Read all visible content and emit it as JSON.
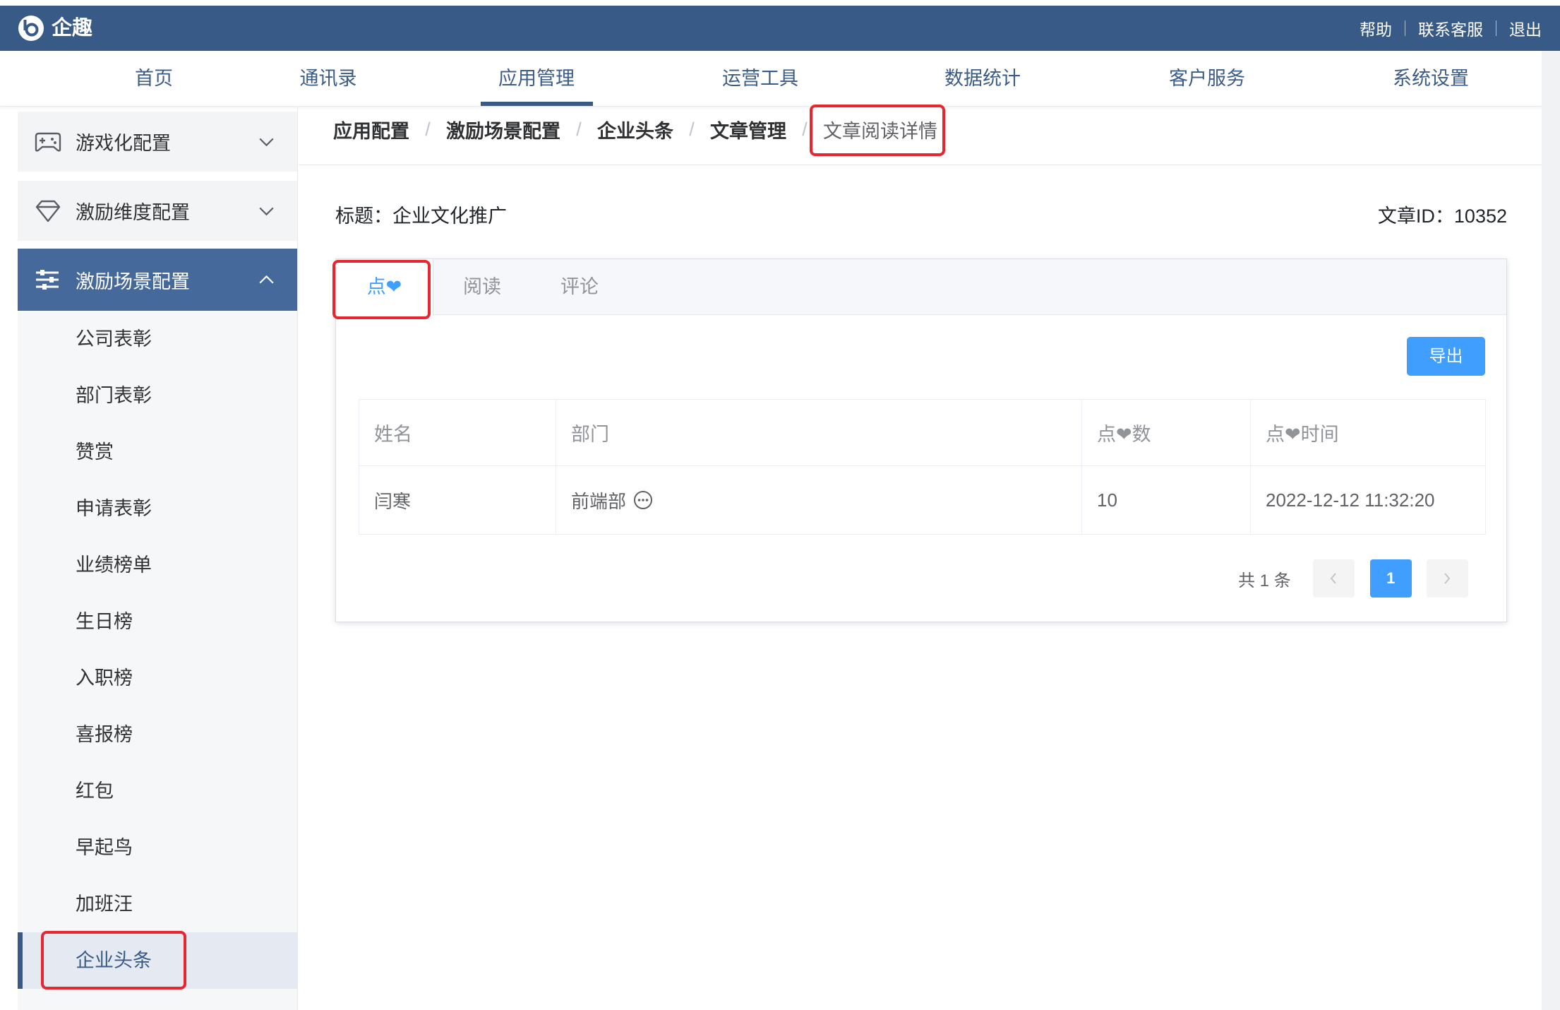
{
  "app": {
    "name": "企趣",
    "logo_icon": "qiqu-logo-icon"
  },
  "topbar": {
    "links": [
      "帮助",
      "联系客服",
      "退出"
    ]
  },
  "nav": {
    "items": [
      "首页",
      "通讯录",
      "应用管理",
      "运营工具",
      "数据统计",
      "客户服务",
      "系统设置"
    ],
    "active": "应用管理"
  },
  "sidebar": {
    "groups": [
      {
        "label": "游戏化配置",
        "icon": "gamepad-icon",
        "expanded": false
      },
      {
        "label": "激励维度配置",
        "icon": "diamond-icon",
        "expanded": false
      },
      {
        "label": "激励场景配置",
        "icon": "sliders-icon",
        "expanded": true
      }
    ],
    "sub_items": [
      "公司表彰",
      "部门表彰",
      "赞赏",
      "申请表彰",
      "业绩榜单",
      "生日榜",
      "入职榜",
      "喜报榜",
      "红包",
      "早起鸟",
      "加班汪",
      "企业头条"
    ],
    "selected": "企业头条"
  },
  "breadcrumb": {
    "items": [
      "应用配置",
      "激励场景配置",
      "企业头条",
      "文章管理",
      "文章阅读详情"
    ],
    "separator": "/"
  },
  "article": {
    "title_label": "标题：",
    "title": "企业文化推广",
    "id_label": "文章ID：",
    "id": "10352"
  },
  "tabs": {
    "items": [
      "点❤",
      "阅读",
      "评论"
    ],
    "active": "点❤"
  },
  "toolbar": {
    "export_label": "导出"
  },
  "table": {
    "columns": [
      "姓名",
      "部门",
      "点❤数",
      "点❤时间"
    ],
    "rows": [
      [
        "闫寒",
        "前端部",
        "10",
        "2022-12-12 11:32:20"
      ]
    ],
    "dept_icon": "more-circle-icon"
  },
  "pagination": {
    "total_text": "共 1 条",
    "current_page": "1",
    "prev_icon": "chevron-left-icon",
    "next_icon": "chevron-right-icon"
  },
  "colors": {
    "topbar": "#385a86",
    "accent": "#409eff",
    "sidebar_active": "#46699b",
    "annotation": "#e8262d"
  }
}
